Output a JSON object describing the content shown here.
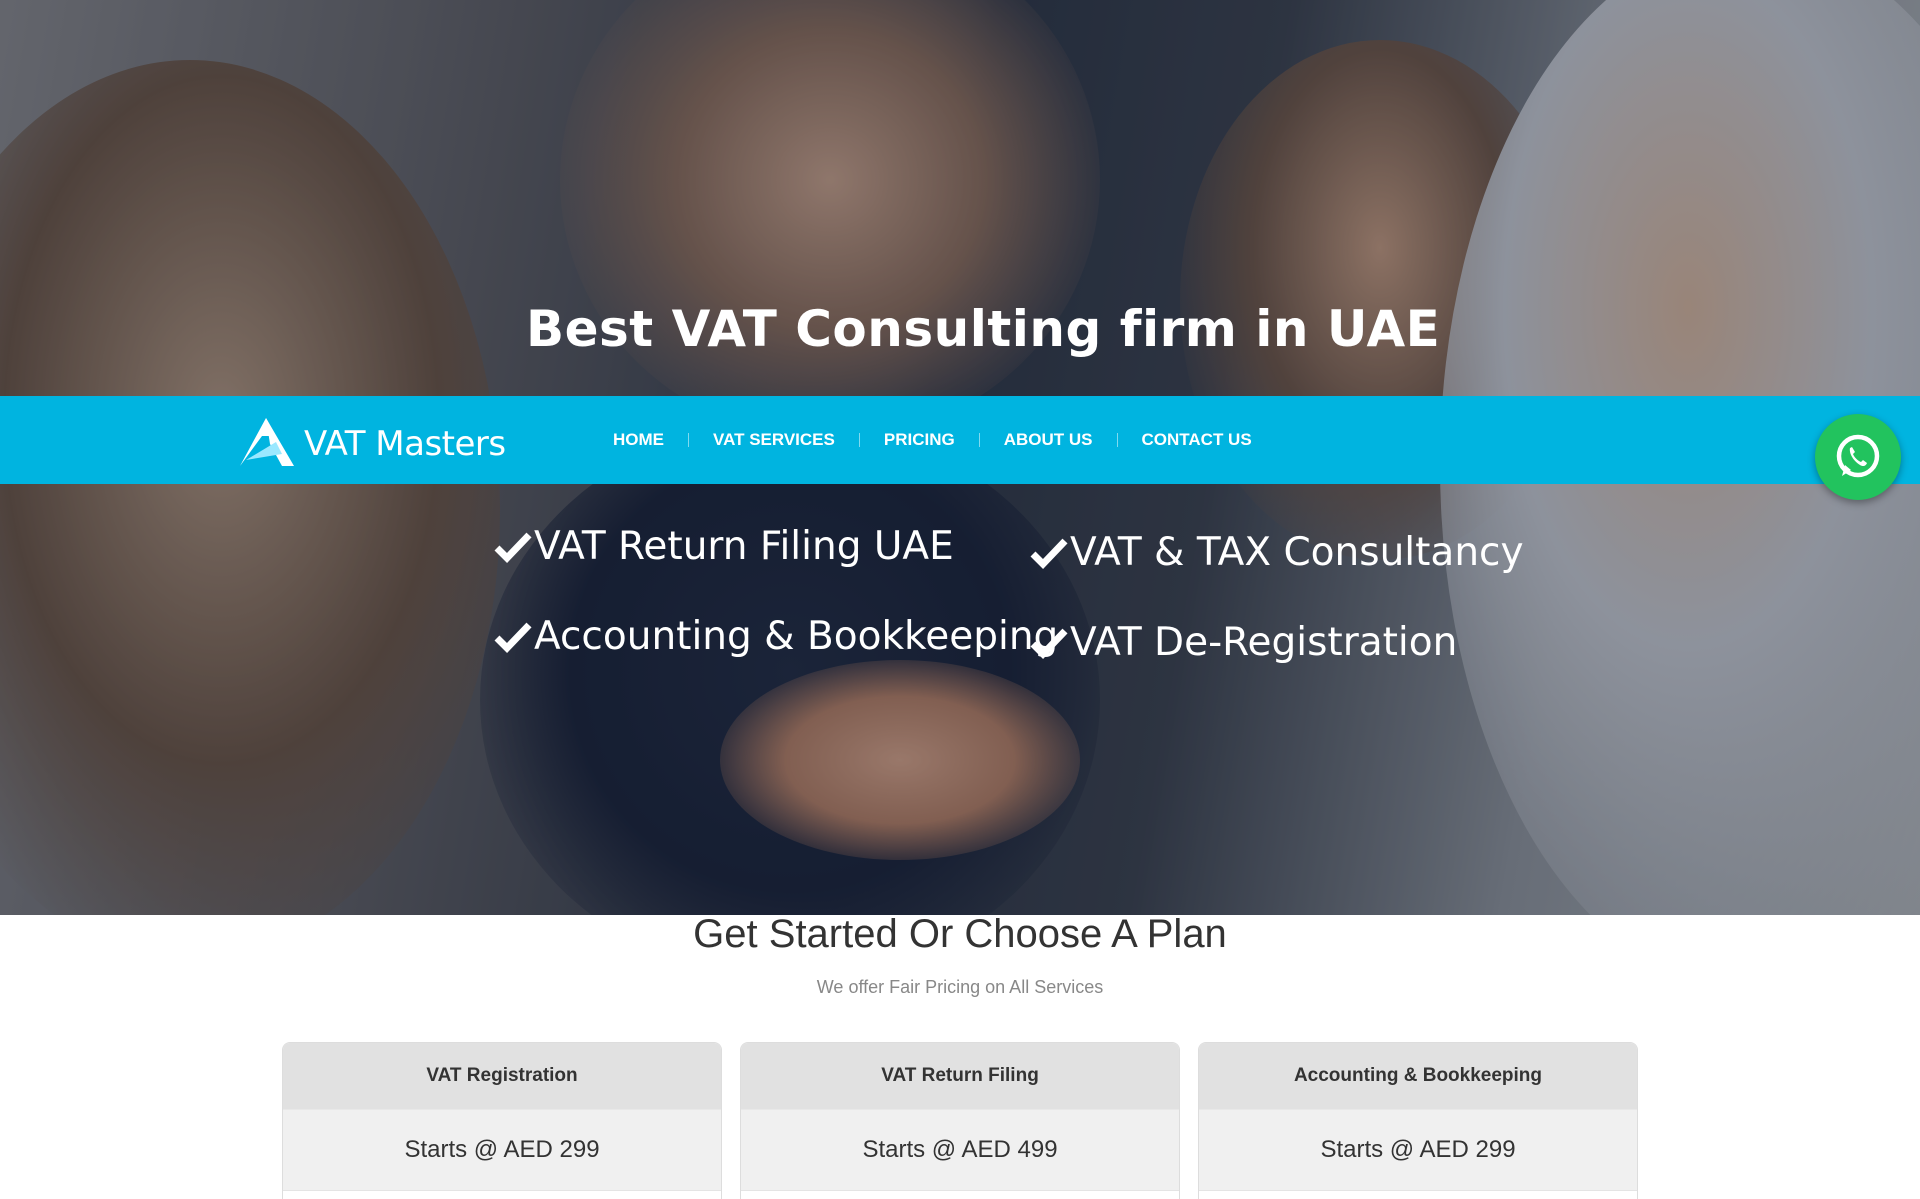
{
  "hero": {
    "title": "Best VAT Consulting firm in UAE",
    "features": [
      "VAT Return Filing UAE",
      "VAT & TAX Consultancy",
      "Accounting & Bookkeeping",
      "VAT De-Registration"
    ]
  },
  "navbar": {
    "brand": "VAT Masters",
    "items": [
      "HOME",
      "VAT SERVICES",
      "PRICING",
      "ABOUT US",
      "CONTACT US"
    ],
    "background": "#00b4e0"
  },
  "whatsapp": {
    "icon": "whatsapp-icon",
    "color": "#22c35e"
  },
  "plans": {
    "title": "Get Started Or Choose A Plan",
    "subtitle": "We offer Fair Pricing on All Services",
    "cards": [
      {
        "name": "VAT Registration",
        "price": "Starts @ AED 299"
      },
      {
        "name": "VAT Return Filing",
        "price": "Starts @ AED 499"
      },
      {
        "name": "Accounting & Bookkeeping",
        "price": "Starts @ AED 299"
      }
    ]
  }
}
